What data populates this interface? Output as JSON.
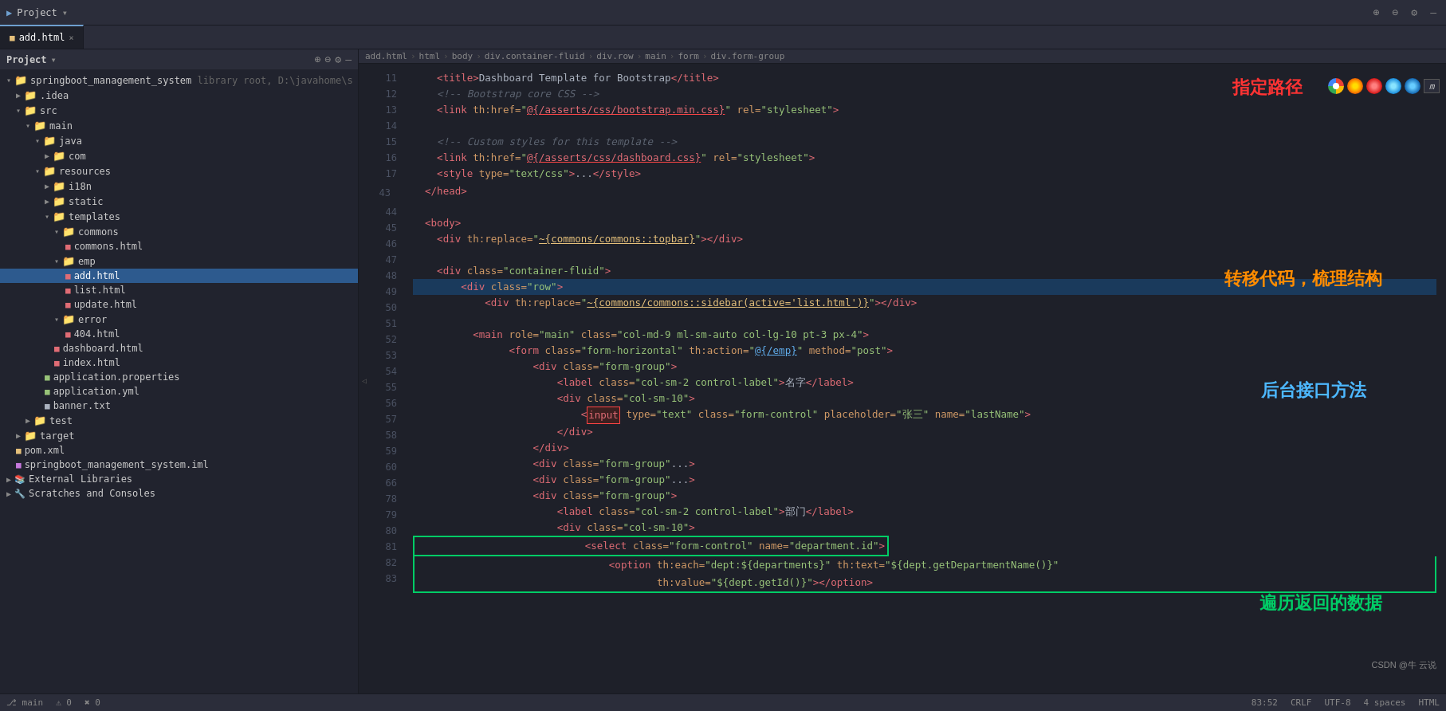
{
  "topbar": {
    "project_icon": "▶",
    "project_label": "Project",
    "dropdown_arrow": "▾",
    "actions": [
      "⊕",
      "⊖",
      "⚙",
      "—"
    ],
    "tab_filename": "add.html",
    "tab_close": "×"
  },
  "sidebar": {
    "title": "Project",
    "actions": [
      "⊕",
      "⊖",
      "⚙"
    ],
    "tree": [
      {
        "id": "springboot",
        "label": "springboot_management_system",
        "type": "root",
        "indent": 0,
        "icon": "folder",
        "suffix": " library root, D:\\javahome\\s"
      },
      {
        "id": "idea",
        "label": ".idea",
        "type": "folder",
        "indent": 1
      },
      {
        "id": "src",
        "label": "src",
        "type": "folder",
        "indent": 1,
        "open": true
      },
      {
        "id": "main",
        "label": "main",
        "type": "folder",
        "indent": 2,
        "open": true
      },
      {
        "id": "java",
        "label": "java",
        "type": "folder",
        "indent": 3,
        "open": true
      },
      {
        "id": "com",
        "label": "com",
        "type": "folder",
        "indent": 4
      },
      {
        "id": "resources",
        "label": "resources",
        "type": "folder",
        "indent": 3,
        "open": true
      },
      {
        "id": "i18n",
        "label": "i18n",
        "type": "folder",
        "indent": 4
      },
      {
        "id": "static",
        "label": "static",
        "type": "folder",
        "indent": 4
      },
      {
        "id": "templates",
        "label": "templates",
        "type": "folder",
        "indent": 4,
        "open": true
      },
      {
        "id": "commons",
        "label": "commons",
        "type": "folder",
        "indent": 5,
        "open": true
      },
      {
        "id": "commons_html",
        "label": "commons.html",
        "type": "html",
        "indent": 6
      },
      {
        "id": "emp",
        "label": "emp",
        "type": "folder",
        "indent": 5,
        "open": true
      },
      {
        "id": "add_html",
        "label": "add.html",
        "type": "html",
        "indent": 6,
        "selected": true
      },
      {
        "id": "list_html",
        "label": "list.html",
        "type": "html",
        "indent": 6
      },
      {
        "id": "update_html",
        "label": "update.html",
        "type": "html",
        "indent": 6
      },
      {
        "id": "error",
        "label": "error",
        "type": "folder",
        "indent": 5,
        "open": true
      },
      {
        "id": "404_html",
        "label": "404.html",
        "type": "html",
        "indent": 6
      },
      {
        "id": "dashboard_html",
        "label": "dashboard.html",
        "type": "html",
        "indent": 5
      },
      {
        "id": "index_html",
        "label": "index.html",
        "type": "html",
        "indent": 5
      },
      {
        "id": "app_props",
        "label": "application.properties",
        "type": "props",
        "indent": 4
      },
      {
        "id": "app_yml",
        "label": "application.yml",
        "type": "yml",
        "indent": 4
      },
      {
        "id": "banner_txt",
        "label": "banner.txt",
        "type": "txt",
        "indent": 4
      },
      {
        "id": "test",
        "label": "test",
        "type": "folder",
        "indent": 2
      },
      {
        "id": "target",
        "label": "target",
        "type": "folder",
        "indent": 1
      },
      {
        "id": "pom_xml",
        "label": "pom.xml",
        "type": "xml",
        "indent": 1
      },
      {
        "id": "system_iml",
        "label": "springboot_management_system.iml",
        "type": "iml",
        "indent": 1
      },
      {
        "id": "ext_libs",
        "label": "External Libraries",
        "type": "folder",
        "indent": 0
      },
      {
        "id": "scratches",
        "label": "Scratches and Consoles",
        "type": "folder",
        "indent": 0
      }
    ]
  },
  "editor": {
    "filename": "add.html",
    "breadcrumbs": [
      "add.html",
      "html",
      "body",
      "div.container-fluid",
      "div.row",
      "main",
      "form",
      "div.form-group"
    ],
    "lines": [
      {
        "num": 11,
        "content": "line11"
      },
      {
        "num": 12,
        "content": "line12"
      },
      {
        "num": 13,
        "content": "line13"
      },
      {
        "num": 14,
        "content": "line14"
      },
      {
        "num": 15,
        "content": "line15"
      },
      {
        "num": 16,
        "content": "line16"
      },
      {
        "num": 17,
        "content": "line17"
      },
      {
        "num": 43,
        "content": "line43"
      },
      {
        "num": 44,
        "content": "line44"
      },
      {
        "num": 45,
        "content": "line45"
      },
      {
        "num": 46,
        "content": "line46"
      },
      {
        "num": 47,
        "content": "line47"
      },
      {
        "num": 48,
        "content": "line48"
      },
      {
        "num": 49,
        "content": "line49"
      },
      {
        "num": 50,
        "content": "line50"
      },
      {
        "num": 51,
        "content": "line51"
      },
      {
        "num": 52,
        "content": "line52"
      },
      {
        "num": 53,
        "content": "line53"
      },
      {
        "num": 54,
        "content": "line54"
      },
      {
        "num": 55,
        "content": "line55"
      },
      {
        "num": 56,
        "content": "line56"
      },
      {
        "num": 57,
        "content": "line57"
      },
      {
        "num": 58,
        "content": "line58"
      },
      {
        "num": 59,
        "content": "line59"
      },
      {
        "num": 60,
        "content": "line60"
      },
      {
        "num": 66,
        "content": "line66"
      },
      {
        "num": 78,
        "content": "line78"
      },
      {
        "num": 79,
        "content": "line79"
      },
      {
        "num": 80,
        "content": "line80"
      },
      {
        "num": 81,
        "content": "line81"
      },
      {
        "num": 82,
        "content": "line82"
      },
      {
        "num": 83,
        "content": "line83"
      }
    ]
  },
  "annotations": {
    "zhiding_lujing": "指定路径",
    "zhuanyi_daiMa": "转移代码，梳理结构",
    "houtai_jieKou": "后台接口方法",
    "liji_fanHui": "遍历返回的数据"
  },
  "browsers": [
    "Chrome",
    "Firefox",
    "Opera",
    "Edge",
    "IE"
  ],
  "watermark": "CSDN @牛 云说",
  "bottombar": {
    "encoding": "UTF-8",
    "line_info": "83:52",
    "crlf": "CRLF",
    "spaces": "4 spaces"
  }
}
